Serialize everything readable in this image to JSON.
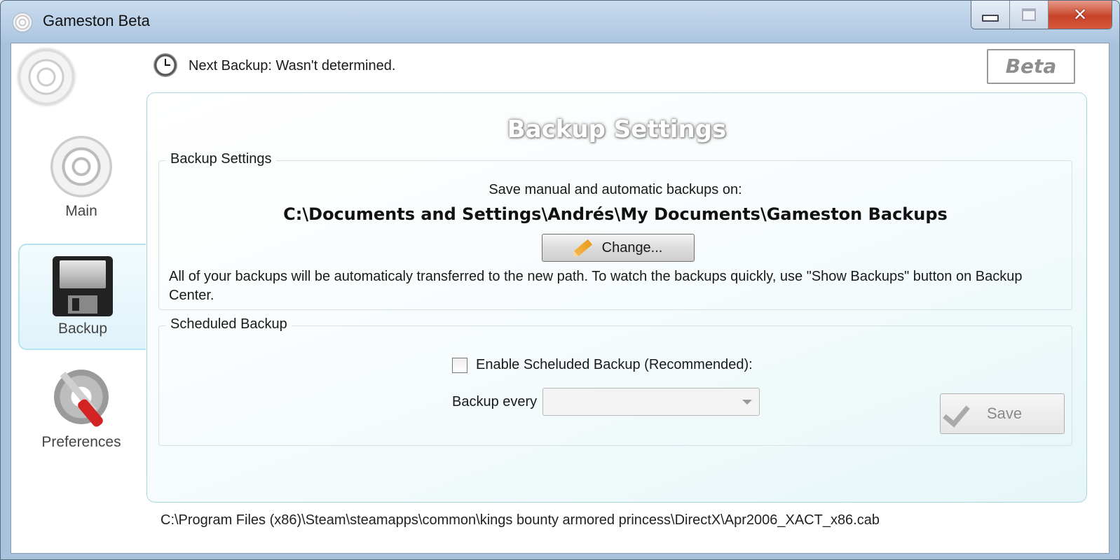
{
  "window": {
    "title": "Gameston Beta"
  },
  "sidebar": {
    "items": [
      {
        "label": "Main",
        "icon": "target-icon"
      },
      {
        "label": "Backup",
        "icon": "floppy-disk-icon"
      },
      {
        "label": "Preferences",
        "icon": "gear-tools-icon"
      }
    ]
  },
  "header": {
    "next_backup": "Next Backup: Wasn't determined.",
    "beta_badge": "Beta"
  },
  "panel": {
    "title": "Backup Settings",
    "backup_settings": {
      "legend": "Backup Settings",
      "save_on_label": "Save manual and automatic backups on:",
      "path": "C:\\Documents and Settings\\Andrés\\My Documents\\Gameston Backups",
      "change_button": "Change...",
      "note": "All of your backups will be automaticaly transferred to the new path. To watch the backups quickly, use \"Show Backups\" button on Backup Center."
    },
    "scheduled_backup": {
      "legend": "Scheduled Backup",
      "enable_label": "Enable Scheluded Backup (Recommended):",
      "enable_checked": false,
      "every_label": "Backup every",
      "every_value": "",
      "save_button": "Save"
    }
  },
  "status": {
    "current_file": "C:\\Program Files (x86)\\Steam\\steamapps\\common\\kings bounty armored princess\\DirectX\\Apr2006_XACT_x86.cab"
  },
  "colors": {
    "accent_border": "#a9d7df",
    "active_nav_bg": "#dff3fa",
    "close_button": "#c7442a"
  }
}
